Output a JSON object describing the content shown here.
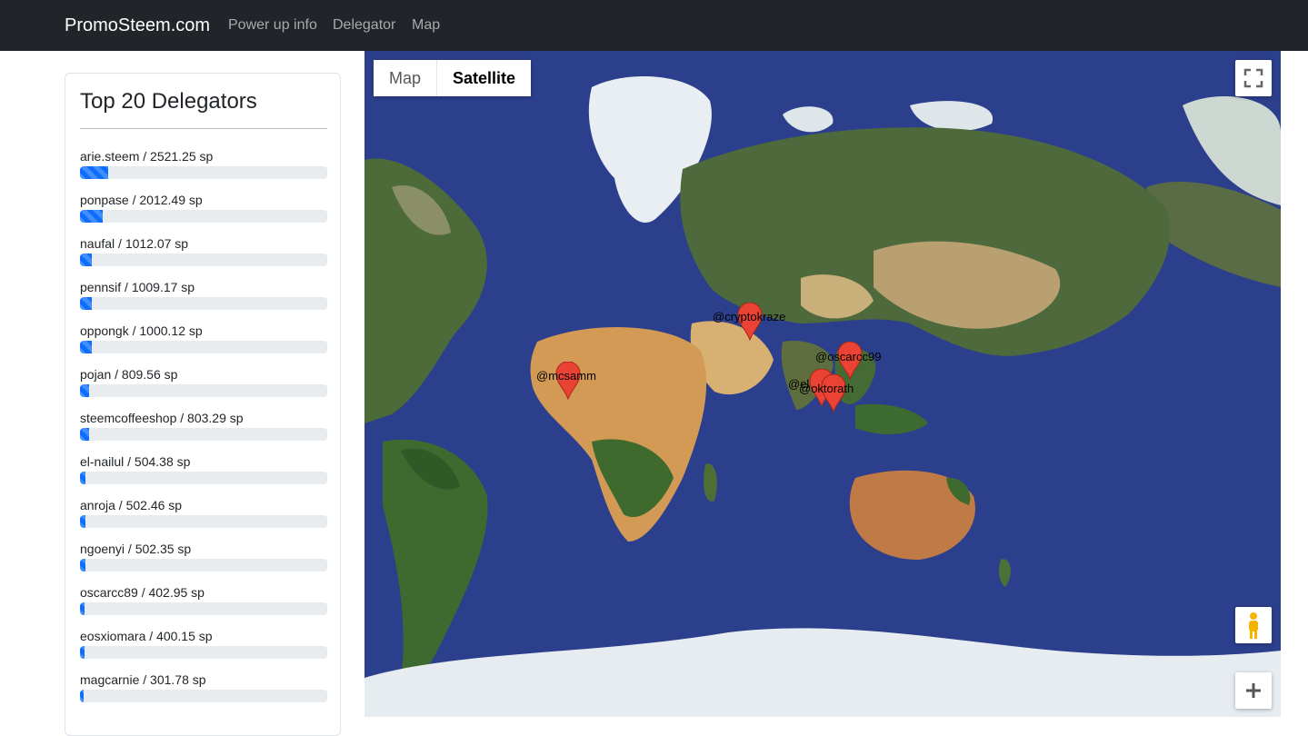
{
  "nav": {
    "brand": "PromoSteem.com",
    "links": [
      "Power up info",
      "Delegator",
      "Map"
    ]
  },
  "sidebar": {
    "title": "Top 20 Delegators",
    "items": [
      {
        "label": "arie.steem / 2521.25 sp",
        "progress": 0.113
      },
      {
        "label": "ponpase / 2012.49 sp",
        "progress": 0.092
      },
      {
        "label": "naufal / 1012.07 sp",
        "progress": 0.047
      },
      {
        "label": "pennsif / 1009.17 sp",
        "progress": 0.047
      },
      {
        "label": "oppongk / 1000.12 sp",
        "progress": 0.046
      },
      {
        "label": "pojan / 809.56 sp",
        "progress": 0.037
      },
      {
        "label": "steemcoffeeshop / 803.29 sp",
        "progress": 0.037
      },
      {
        "label": "el-nailul / 504.38 sp",
        "progress": 0.023
      },
      {
        "label": "anroja / 502.46 sp",
        "progress": 0.023
      },
      {
        "label": "ngoenyi / 502.35 sp",
        "progress": 0.023
      },
      {
        "label": "oscarcc89 / 402.95 sp",
        "progress": 0.018
      },
      {
        "label": "eosxiomara / 400.15 sp",
        "progress": 0.018
      },
      {
        "label": "magcarnie / 301.78 sp",
        "progress": 0.014
      }
    ]
  },
  "map": {
    "type_map": "Map",
    "type_satellite": "Satellite",
    "selected_type": "Satellite",
    "fullscreen_icon": "fullscreen-icon",
    "pegman_icon": "pegman-icon",
    "zoom_in_icon": "plus-icon",
    "markers": [
      {
        "label": "@cryptokraze"
      },
      {
        "label": "@oscarcc99"
      },
      {
        "label": "@mcsamm"
      },
      {
        "label": "@oktorath"
      },
      {
        "label": "@el"
      }
    ],
    "colors": {
      "ocean": "#2c3f8c",
      "marker": "#ea4335",
      "progress": "#0d6efd"
    }
  }
}
